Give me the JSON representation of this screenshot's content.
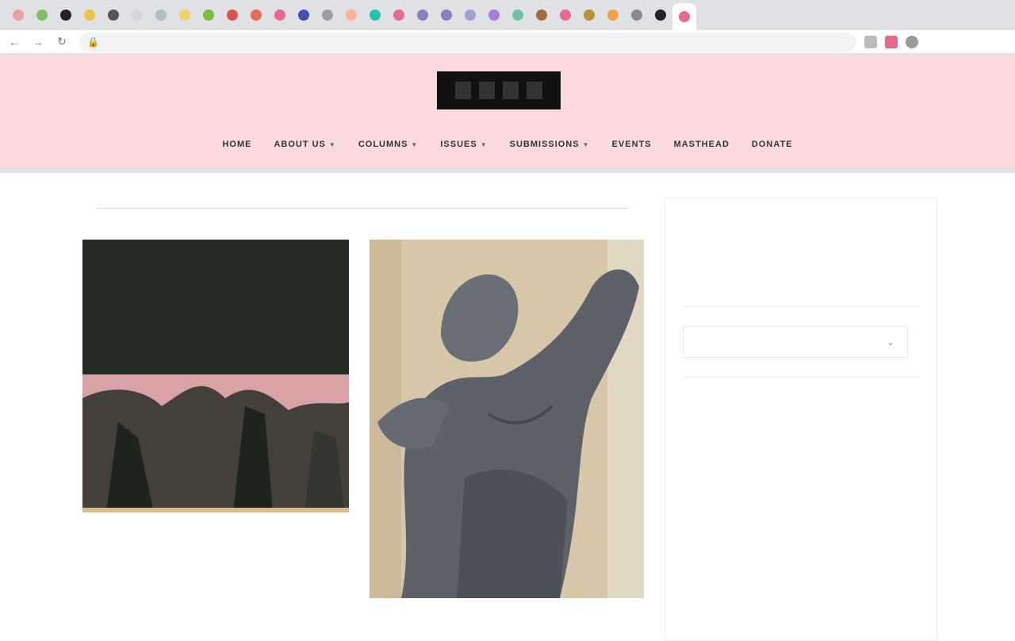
{
  "browser": {
    "tab_colors": [
      "#e8a2a0",
      "#7dbf6a",
      "#222222",
      "#e8c54a",
      "#555555",
      "#cfd8dc",
      "#b0bec5",
      "#f2d16b",
      "#7cbf3a",
      "#d9534f",
      "#e86a5a",
      "#e86a8a",
      "#3f51b5",
      "#9e9e9e",
      "#ffb199",
      "#25c2b0",
      "#e86a8a",
      "#8e7cc3",
      "#8e7cc3",
      "#a0a0d0",
      "#a97ce0",
      "#6fc3a0",
      "#a56b3a",
      "#e86a8a",
      "#b8913a",
      "#f5a048",
      "#8a8a8a",
      "#222222",
      "#e86a8a"
    ],
    "url": "",
    "nav": {
      "back_icon": "arrow-left-icon",
      "forward_icon": "arrow-right-icon",
      "reload_icon": "reload-icon"
    }
  },
  "header": {
    "bg": "#fadadd",
    "logo_text": "",
    "menu": [
      {
        "label": "Home",
        "has_caret": false
      },
      {
        "label": "About Us",
        "has_caret": true
      },
      {
        "label": "Columns",
        "has_caret": true
      },
      {
        "label": "Issues",
        "has_caret": true
      },
      {
        "label": "Submissions",
        "has_caret": true
      },
      {
        "label": "Events",
        "has_caret": false
      },
      {
        "label": "Masthead",
        "has_caret": false
      },
      {
        "label": "Donate",
        "has_caret": false
      }
    ]
  },
  "main": {
    "category_title": "",
    "view_all": "",
    "posts": [
      {
        "meta": "",
        "title": "",
        "excerpt": ""
      },
      {
        "meta": "",
        "title": "",
        "excerpt": ""
      }
    ]
  },
  "sidebar": {
    "widgets": [
      {
        "title": "",
        "items": []
      },
      {
        "title": "",
        "select_placeholder": ""
      },
      {
        "title": "",
        "items": []
      }
    ]
  }
}
